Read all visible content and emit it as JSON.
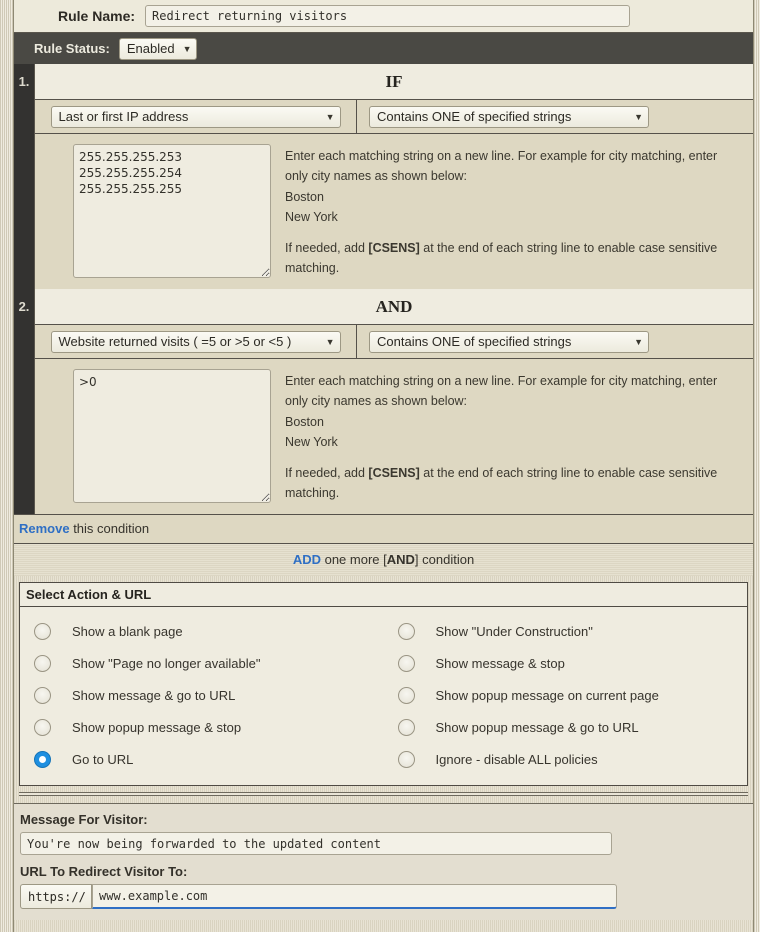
{
  "rule": {
    "name_label": "Rule Name:",
    "name_value": "Redirect returning visitors",
    "status_label": "Rule Status:",
    "status_value": "Enabled"
  },
  "conditions": [
    {
      "number": "1.",
      "title": "IF",
      "field_select": "Last or first IP address",
      "operator_select": "Contains ONE of specified strings",
      "strings_value": "255.255.255.253\n255.255.255.254\n255.255.255.255",
      "hint_line1": "Enter each matching string on a new line. For example for city matching, enter only city names as shown below:",
      "hint_line2": "Boston",
      "hint_line3": "New York",
      "hint_line4_pre": "If needed, add ",
      "hint_line4_bold": "[CSENS]",
      "hint_line4_post": " at the end of each string line to enable case sensitive matching."
    },
    {
      "number": "2.",
      "title": "AND",
      "field_select": "Website returned visits ( =5 or >5 or <5 )",
      "operator_select": "Contains ONE of specified strings",
      "strings_value": ">0",
      "hint_line1": "Enter each matching string on a new line. For example for city matching, enter only city names as shown below:",
      "hint_line2": "Boston",
      "hint_line3": "New York",
      "hint_line4_pre": "If needed, add ",
      "hint_line4_bold": "[CSENS]",
      "hint_line4_post": " at the end of each string line to enable case sensitive matching."
    }
  ],
  "remove_row": {
    "link": "Remove",
    "rest": " this condition"
  },
  "add_row": {
    "link": "ADD",
    "mid": " one more [",
    "bold": "AND",
    "end": "] condition"
  },
  "action_panel": {
    "header": "Select Action & URL",
    "options_left": [
      {
        "label": "Show a blank page",
        "selected": false
      },
      {
        "label": "Show \"Page no longer available\"",
        "selected": false
      },
      {
        "label": "Show message & go to URL",
        "selected": false
      },
      {
        "label": "Show popup message & stop",
        "selected": false
      },
      {
        "label": "Go to URL",
        "selected": true
      }
    ],
    "options_right": [
      {
        "label": "Show \"Under Construction\"",
        "selected": false
      },
      {
        "label": "Show message & stop",
        "selected": false
      },
      {
        "label": "Show popup message on current page",
        "selected": false
      },
      {
        "label": "Show popup message & go to URL",
        "selected": false
      },
      {
        "label": "Ignore - disable ALL policies",
        "selected": false
      }
    ]
  },
  "bottom": {
    "message_label": "Message For Visitor:",
    "message_value": "You're now being forwarded to the updated content",
    "url_label": "URL To Redirect Visitor To:",
    "protocol_value": "https://",
    "url_value": "www.example.com"
  },
  "icons": {
    "caret": "▼"
  },
  "colors": {
    "accent_blue": "#1f8fe0",
    "link_blue": "#2f6fc4",
    "dark_band": "#4a4944",
    "gutter": "#333230"
  }
}
